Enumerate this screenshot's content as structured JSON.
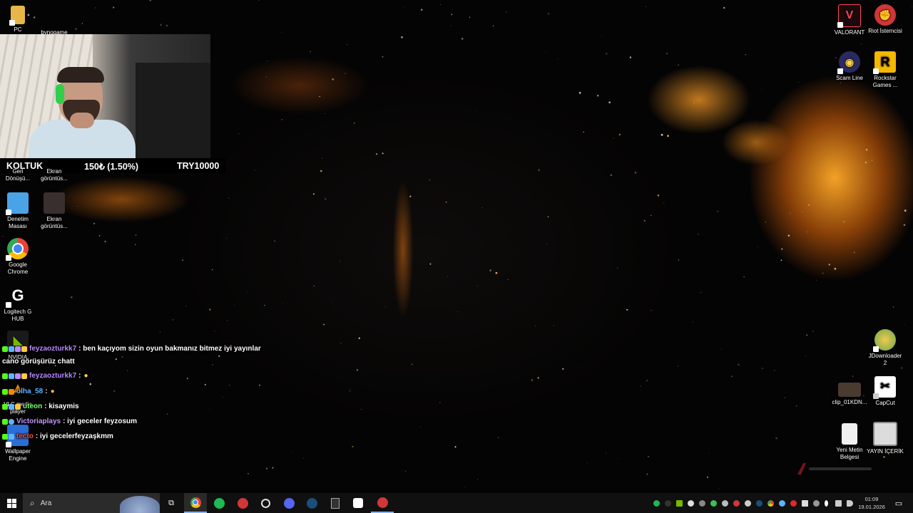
{
  "desktop_icons_left": [
    {
      "label": "PC",
      "icon": "folder-icon",
      "color": "#e6b64a"
    },
    {
      "label": "bynoqame",
      "icon": "user-folder-icon",
      "color": "#e6b64a"
    },
    {
      "label": "Geri\nDönüşü...",
      "icon": "recycle-bin-icon",
      "color": "#9aa7b5"
    },
    {
      "label": "Ekran\ngörüntüs...",
      "icon": "screenshot-icon",
      "color": "#555555"
    },
    {
      "label": "Denetim\nMasası",
      "icon": "control-panel-icon",
      "color": "#4aa3e6"
    },
    {
      "label": "Ekran\ngörüntüs...",
      "icon": "screenshot-icon",
      "color": "#3a2f2f"
    },
    {
      "label": "Google\nChrome",
      "icon": "chrome-icon",
      "color": "#4285f4"
    },
    {
      "label": "Logitech G\nHUB",
      "icon": "logitech-icon",
      "color": "#ffffff"
    },
    {
      "label": "NVIDIA",
      "icon": "nvidia-icon",
      "color": "#76b900"
    },
    {
      "label": "VLC media\nplayer",
      "icon": "vlc-icon",
      "color": "#f08a00"
    },
    {
      "label": "Wallpaper\nEngine",
      "icon": "wallpaper-engine-icon",
      "color": "#2b6fd6"
    }
  ],
  "desktop_icons_right": [
    {
      "label": "VALORANT",
      "icon": "valorant-icon",
      "color": "#ff4655"
    },
    {
      "label": "Riot İstemcisi",
      "icon": "riot-icon",
      "color": "#d13639"
    },
    {
      "label": "Scam Line",
      "icon": "scam-line-icon",
      "color": "#3a3a80"
    },
    {
      "label": "Rockstar\nGames ...",
      "icon": "rockstar-icon",
      "color": "#f5b700"
    },
    {
      "label": "JDownloader\n2",
      "icon": "jdownloader-icon",
      "color": "#f2c94c"
    },
    {
      "label": "clip_01KDN...",
      "icon": "video-file-icon",
      "color": "#4a3b30"
    },
    {
      "label": "CapCut",
      "icon": "capcut-icon",
      "color": "#ffffff"
    },
    {
      "label": "Yeni Metin\nBelgesi",
      "icon": "text-file-icon",
      "color": "#f0f0f0"
    },
    {
      "label": "YAYIN İÇERİK",
      "icon": "monitor-icon",
      "color": "#dcdcdc"
    }
  ],
  "stream_overlay": {
    "label": "KOLTUK",
    "amount": "150₺ (1.50%)",
    "goal": "TRY10000"
  },
  "chat": [
    {
      "user": "feyzaozturkk7",
      "user_color": "#b889ff",
      "message": ": ben kaçıyom sizin oyun bakmanız bitmez iyi yayınlar",
      "continuation": "cano görüşürüz chatt"
    },
    {
      "user": "feyzaozturkk7",
      "user_color": "#b889ff",
      "message": ":",
      "emote": "bird-emote"
    },
    {
      "user": "olha_58",
      "user_color": "#5fb3ff",
      "message": ":",
      "emote": "cat-emote"
    },
    {
      "user": "uteon",
      "user_color": "#7cff6b",
      "message": ": kisaymis"
    },
    {
      "user": "Victoriaplays",
      "user_color": "#c596ff",
      "message": ": iyi geceler feyzosum"
    },
    {
      "user": "tecto",
      "user_color": "#ff4b4b",
      "message": ": iyi gecelerfeyzaşkmm"
    }
  ],
  "taskbar": {
    "search_placeholder": "Ara",
    "apps": [
      "task-view-icon",
      "chrome-icon",
      "spotify-icon",
      "riot-client-icon",
      "valorant-tracker-icon",
      "discord-icon",
      "steam-icon",
      "epic-games-icon",
      "capcut-icon",
      "riot-icon"
    ],
    "time": "01:09",
    "date": "19.01.2026"
  }
}
